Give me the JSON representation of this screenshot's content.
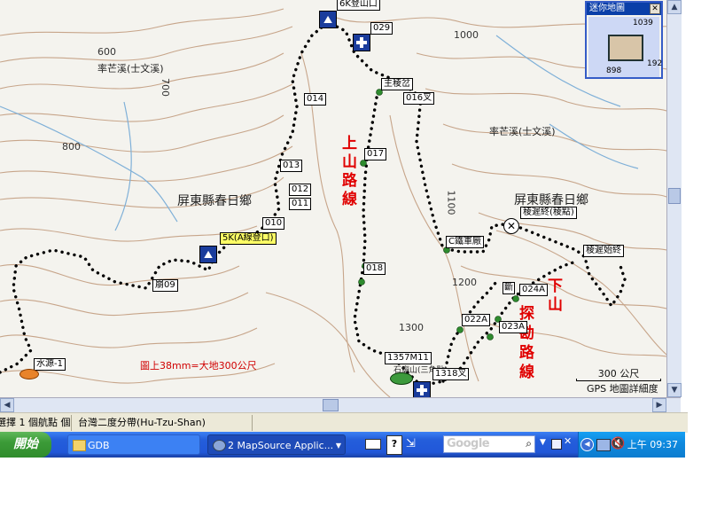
{
  "map": {
    "contour_labels": [
      "600",
      "700",
      "800",
      "1000",
      "1100",
      "1200",
      "1300"
    ],
    "place_labels": {
      "stream_1": "率芒溪(士文溪)",
      "stream_2": "率芒溪(士文溪)",
      "township_1": "屏東縣春日鄉",
      "township_2": "屏東縣春日鄉"
    },
    "waypoints": {
      "trailhead_6k": "6K登山口",
      "wp029": "029",
      "wp014": "014",
      "wp013": "013",
      "wp012": "012",
      "wp011": "011",
      "wp010": "010",
      "trailhead_5k": "5K(A線登口)",
      "wp09": "崩09",
      "water": "水源-1",
      "junction": "主稜岔",
      "wp016": "016叉",
      "wp017": "017",
      "wp018": "018",
      "truck_end": "C鐵軍廠",
      "ridge_1": "稜遲終(稜點)",
      "ridge_2": "稜遲始終",
      "wp024a": "024A",
      "fall": "斷",
      "wp022a": "022A",
      "wp023a": "023A",
      "summit": "1357M11",
      "summit_note": "石廟山(三角點)",
      "wp318": "1318叉"
    },
    "route_up": "上山路線",
    "route_scout": "探勘路線",
    "route_down": "下山",
    "scale_note": "圖上38mm=大地300公尺",
    "scale_bar": "300 公尺",
    "detail_note": "GPS 地圖詳細度",
    "colors": {
      "contour": "#c7a58a",
      "river": "#7fb0d8",
      "track": "#000000",
      "wp_dot": "#2e8b2e",
      "route_text": "#e00000"
    }
  },
  "mini_map": {
    "title": "迷你地圖",
    "close_label": "✕",
    "labels": [
      "1039",
      "898",
      "192"
    ]
  },
  "statusbar": {
    "cell1": "選擇 1 個航點 個",
    "cell2": "台灣二度分帶(Hu-Tzu-Shan)"
  },
  "taskbar": {
    "start_label": "開始",
    "task_gdb": "GDB",
    "task_mapsource": "2 MapSource Applic...",
    "search_placeholder": "Google",
    "clock": "上午 09:37"
  }
}
